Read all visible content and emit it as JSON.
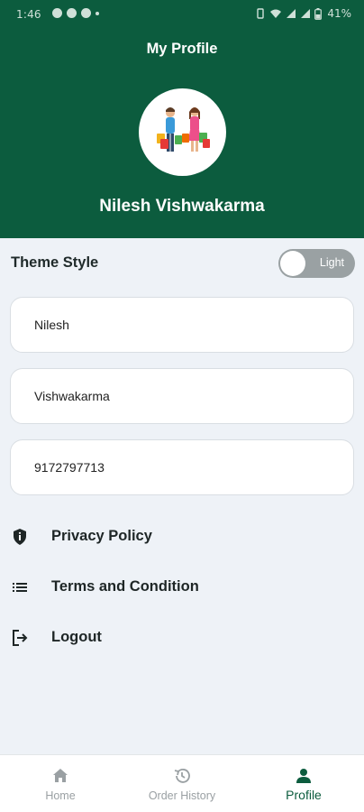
{
  "status_bar": {
    "time": "1:46",
    "battery": "41%"
  },
  "header": {
    "title": "My Profile",
    "user_name": "Nilesh Vishwakarma"
  },
  "theme": {
    "label": "Theme Style",
    "toggle_label": "Light"
  },
  "fields": [
    {
      "value": "Nilesh"
    },
    {
      "value": "Vishwakarma"
    },
    {
      "value": "9172797713"
    }
  ],
  "menu": [
    {
      "label": "Privacy Policy",
      "icon": "shield-icon"
    },
    {
      "label": "Terms and Condition",
      "icon": "list-icon"
    },
    {
      "label": "Logout",
      "icon": "logout-icon"
    }
  ],
  "bottom_nav": [
    {
      "label": "Home",
      "icon": "home-icon"
    },
    {
      "label": "Order History",
      "icon": "history-icon"
    },
    {
      "label": "Profile",
      "icon": "person-icon",
      "active": true
    }
  ],
  "colors": {
    "primary": "#0c5c3e",
    "background": "#eef2f7",
    "toggle_off": "#9aa1a3",
    "inactive": "#9aa0a3"
  }
}
